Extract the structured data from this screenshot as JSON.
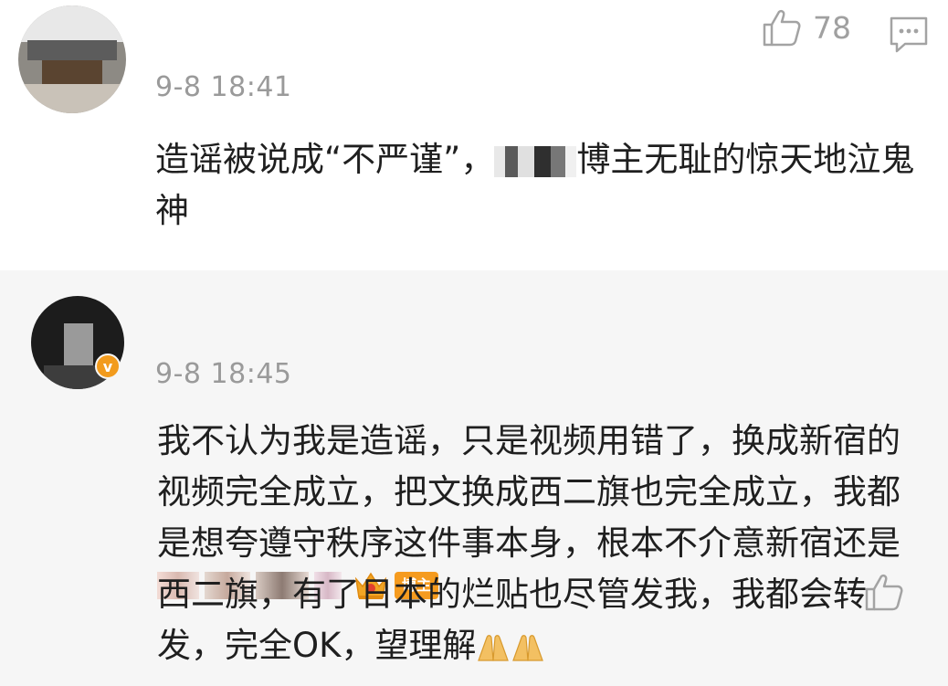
{
  "comment1": {
    "time": "9-8 18:41",
    "like_count": "78",
    "text_a": "造谣被说成“不严谨”，",
    "text_b": "博主无耻的惊天地泣鬼神"
  },
  "comment2": {
    "time": "9-8 18:45",
    "blogger_tag": "博主",
    "verified_badge": "v",
    "text": "我不认为我是造谣，只是视频用错了，换成新宿的视频完全成立，把文换成西二旗也完全成立，我都是想夸遵守秩序这件事本身，根本不介意新宿还是西二旗，有了日本的烂贴也尽管发我，我都会转发，完全OK，望理解"
  },
  "icons": {
    "like": "thumbs-up-icon",
    "reply": "comment-bubble-icon",
    "crown": "crown-badge-icon",
    "emoji": "praying-hands-emoji"
  },
  "colors": {
    "blogger_tag": "#f59b1f",
    "verified": "#f29b1d",
    "timestamp": "#9a9a9a",
    "reply_background": "#f6f6f6"
  }
}
